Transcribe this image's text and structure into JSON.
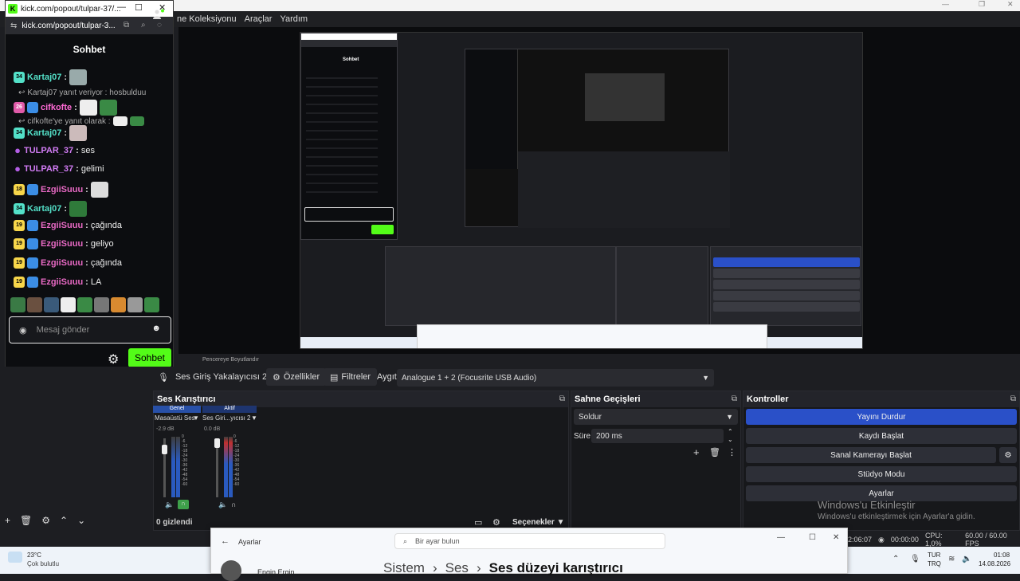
{
  "obs": {
    "menu": [
      "ne Koleksiyonu",
      "Araçlar",
      "Yardım"
    ],
    "source_name": "Ses Giriş Yakalayıcısı 2",
    "properties_label": "Özellikler",
    "filters_label": "Filtreler",
    "device_label": "Aygıt",
    "device_value": "Analogue 1 + 2 (Focusrite USB Audio)",
    "preview_bar_label": "Pencereye Boyutlandır",
    "mixer": {
      "title": "Ses Karıştırıcı",
      "tab_general": "Genel",
      "tab_active": "Aktif",
      "channels": [
        {
          "name": "Masaüstü Ses",
          "db": "-2.9 dB"
        },
        {
          "name": "Ses Giri...yıcısı 2",
          "db": "0.0 dB"
        }
      ],
      "scale": [
        "0",
        "-6",
        "-12",
        "-18",
        "-24",
        "-30",
        "-36",
        "-42",
        "-48",
        "-54",
        "-60"
      ],
      "hidden": "0 gizlendi",
      "options": "Seçenekler"
    },
    "transitions": {
      "title": "Sahne Geçişleri",
      "type": "Soldur",
      "duration_label": "Süre",
      "duration_value": "200 ms"
    },
    "controls": {
      "title": "Kontroller",
      "stop_stream": "Yayını Durdur",
      "start_record": "Kaydı Başlat",
      "start_vcam": "Sanal Kamerayı Başlat",
      "studio_mode": "Stüdyo Modu",
      "settings": "Ayarlar"
    },
    "activate": {
      "title": "Windows'u Etkinleştir",
      "sub": "Windows'u etkinleştirmek için Ayarlar'a gidin."
    },
    "status": {
      "time1": "2:06:07",
      "time2": "00:00:00",
      "cpu": "CPU: 1,0%",
      "fps": "60.00 / 60.00 FPS"
    },
    "accent": "#2a50c8"
  },
  "chat": {
    "window_title": "kick.com/popout/tulpar-37/...",
    "url": "kick.com/popout/tulpar-3...",
    "header": "Sohbet",
    "placeholder": "Mesaj gönder",
    "send": "Sohbet",
    "brand_color": "#53fc18",
    "messages": [
      {
        "badge": "34",
        "user": "Kartaj07",
        "text": ""
      },
      {
        "reply": "Kartaj07 yanıt veriyor : hosbulduu"
      },
      {
        "badge": "26",
        "user": "cifkofte",
        "text": ""
      },
      {
        "reply": "cifkofte'ye yanıt olarak :"
      },
      {
        "badge": "34",
        "user": "Kartaj07",
        "text": ""
      },
      {
        "user": "TULPAR_37",
        "text": "ses"
      },
      {
        "user": "TULPAR_37",
        "text": "gelimi"
      },
      {
        "badge": "18",
        "user": "EzgiiSuuu",
        "text": ""
      },
      {
        "badge": "34",
        "user": "Kartaj07",
        "text": ""
      },
      {
        "badge": "19",
        "user": "EzgiiSuuu",
        "text": "çağında"
      },
      {
        "badge": "19",
        "user": "EzgiiSuuu",
        "text": "geliyo"
      },
      {
        "badge": "19",
        "user": "EzgiiSuuu",
        "text": "çağında"
      },
      {
        "badge": "19",
        "user": "EzgiiSuuu",
        "text": "LA"
      }
    ]
  },
  "settings_window": {
    "app": "Ayarlar",
    "search": "Bir ayar bulun",
    "user": "Engin Ergin",
    "breadcrumb": [
      "Sistem",
      "Ses",
      "Ses düzeyi karıştırıcı"
    ]
  },
  "taskbar": {
    "weather_temp": "23°C",
    "weather_desc": "Çok bulutlu",
    "lang1": "TUR",
    "lang2": "TRQ",
    "clock": "01:08",
    "date": "14.08.2026"
  }
}
